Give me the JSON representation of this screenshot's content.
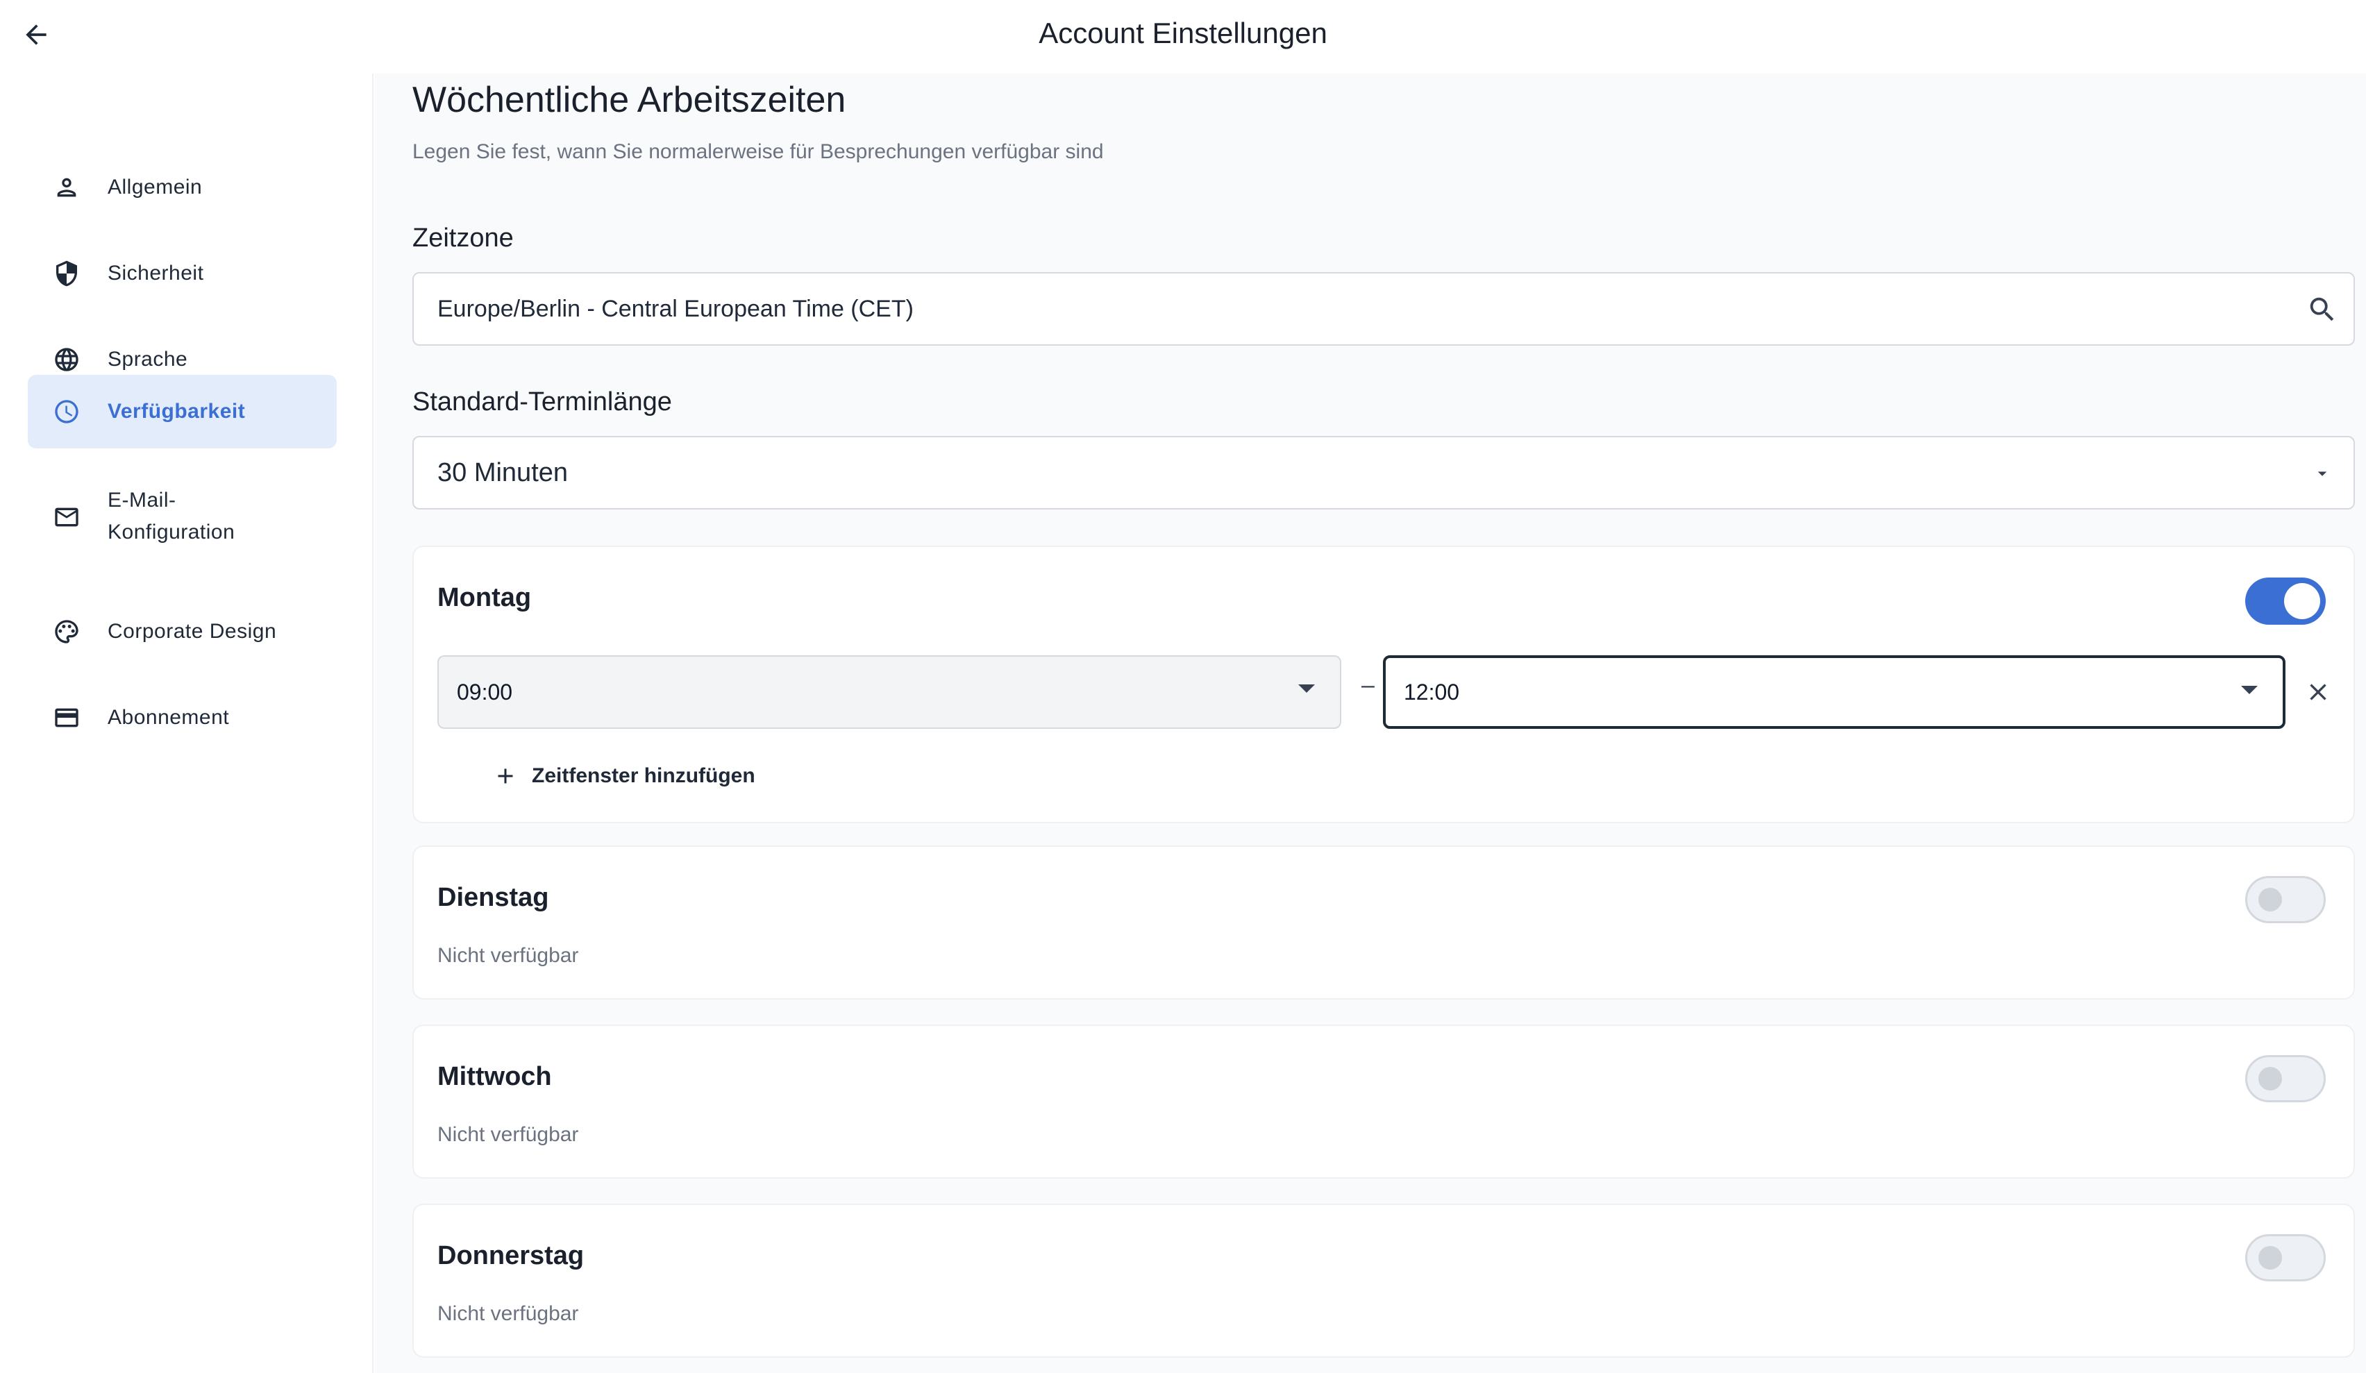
{
  "header": {
    "title": "Account Einstellungen"
  },
  "sidebar": {
    "items": [
      {
        "label": "Allgemein",
        "icon": "person-icon",
        "active": false
      },
      {
        "label": "Sicherheit",
        "icon": "shield-icon",
        "active": false
      },
      {
        "label": "Sprache",
        "icon": "globe-icon",
        "active": false
      },
      {
        "label": "Verfügbarkeit",
        "icon": "clock-icon",
        "active": true
      },
      {
        "label": "E-Mail-\nKonfiguration",
        "icon": "mail-icon",
        "active": false
      },
      {
        "label": "Corporate Design",
        "icon": "palette-icon",
        "active": false
      },
      {
        "label": "Abonnement",
        "icon": "credit-card-icon",
        "active": false
      }
    ]
  },
  "main": {
    "title": "Wöchentliche Arbeitszeiten",
    "subtitle": "Legen Sie fest, wann Sie normalerweise für Besprechungen verfügbar sind",
    "timezone": {
      "label": "Zeitzone",
      "value": "Europe/Berlin - Central European Time (CET)"
    },
    "duration": {
      "label": "Standard-Terminlänge",
      "value": "30 Minuten"
    },
    "days": [
      {
        "name": "Montag",
        "enabled": true,
        "slots": [
          {
            "from": "09:00",
            "to": "12:00"
          }
        ],
        "add_label": "Zeitfenster hinzufügen",
        "separator": "–"
      },
      {
        "name": "Dienstag",
        "enabled": false,
        "status": "Nicht verfügbar"
      },
      {
        "name": "Mittwoch",
        "enabled": false,
        "status": "Nicht verfügbar"
      },
      {
        "name": "Donnerstag",
        "enabled": false,
        "status": "Nicht verfügbar"
      }
    ]
  },
  "colors": {
    "accent": "#3b6fd4",
    "active_bg": "#e3ecfb",
    "text": "#1a202c",
    "muted": "#6b7280"
  }
}
